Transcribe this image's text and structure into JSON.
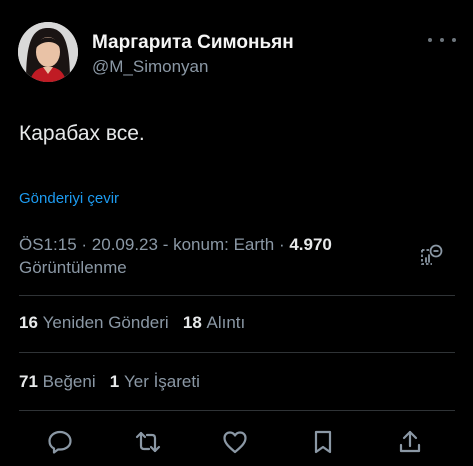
{
  "author": {
    "name": "Маргарита Симоньян",
    "handle": "@M_Simonyan"
  },
  "tweet": {
    "text": "Карабах все.",
    "translate_label": "Gönderiyi çevir"
  },
  "meta": {
    "time": "ÖS1:15",
    "date": "20.09.23",
    "location": "konum: Earth",
    "views_count": "4.970",
    "views_label": "Görüntülenme"
  },
  "stats": {
    "reposts_count": "16",
    "reposts_label": "Yeniden Gönderi",
    "quotes_count": "18",
    "quotes_label": "Alıntı",
    "likes_count": "71",
    "likes_label": "Beğeni",
    "bookmarks_count": "1",
    "bookmarks_label": "Yer İşareti"
  },
  "colors": {
    "background": "#000000",
    "text": "#e7e9ea",
    "secondary": "#8b98a5",
    "link": "#1d9bf0",
    "divider": "#2f3336"
  },
  "icons": [
    "more-icon",
    "analytics-icon",
    "reply-icon",
    "repost-icon",
    "like-icon",
    "bookmark-icon",
    "share-icon"
  ]
}
